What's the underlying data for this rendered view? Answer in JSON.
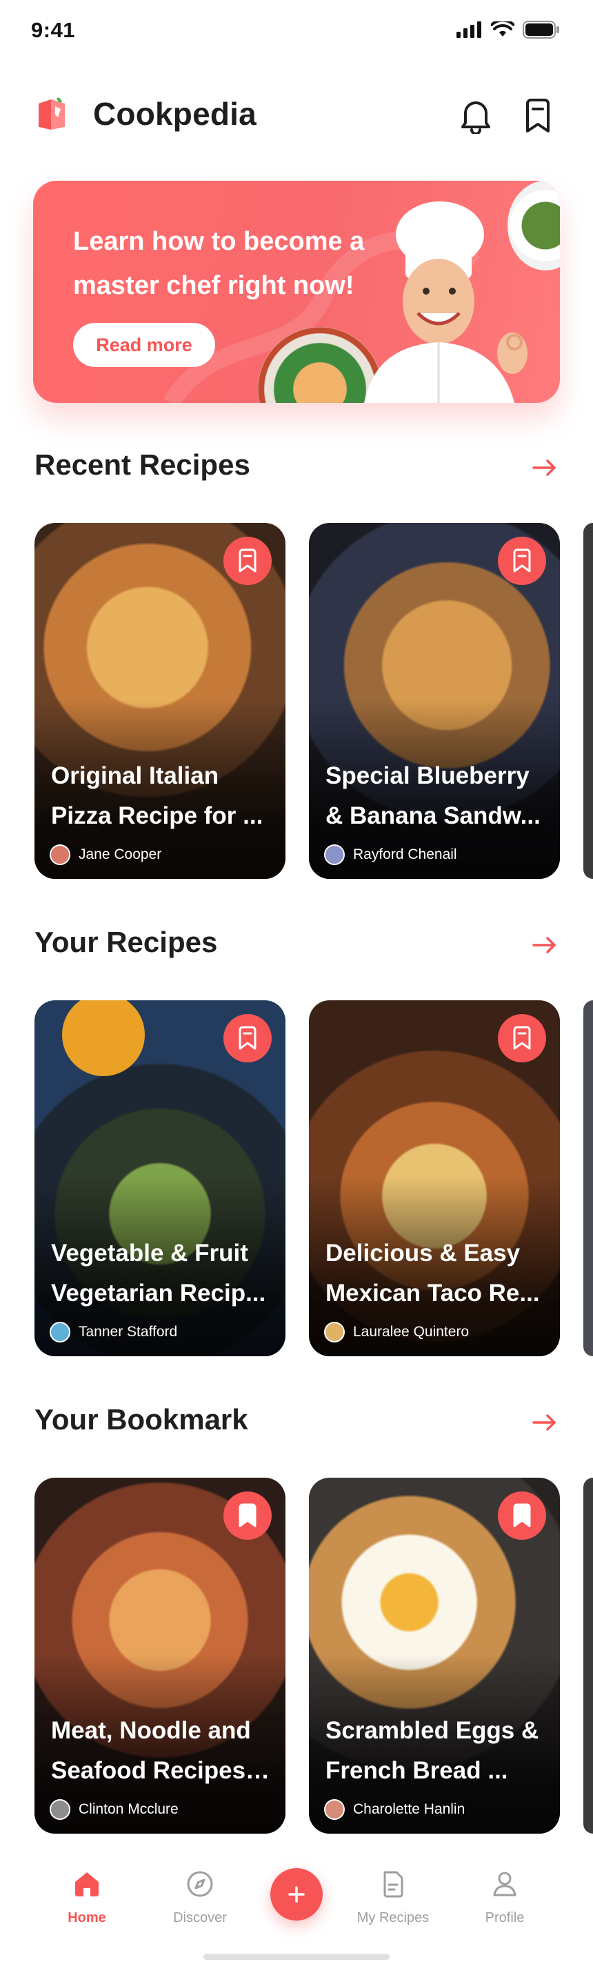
{
  "status_bar": {
    "time": "9:41"
  },
  "header": {
    "app_title": "Cookpedia"
  },
  "banner": {
    "text": "Learn how to become a master chef right now!",
    "button_label": "Read more"
  },
  "sections": [
    {
      "title": "Recent Recipes",
      "cards": [
        {
          "title": "Original Italian Pizza Recipe for ...",
          "author": "Jane Cooper",
          "bookmarked": false
        },
        {
          "title": "Special Blueberry & Banana Sandw...",
          "author": "Rayford Chenail",
          "bookmarked": false
        }
      ]
    },
    {
      "title": "Your Recipes",
      "cards": [
        {
          "title": "Vegetable & Fruit Vegetarian Recip...",
          "author": "Tanner Stafford",
          "bookmarked": false
        },
        {
          "title": "Delicious & Easy Mexican Taco Re...",
          "author": "Lauralee Quintero",
          "bookmarked": false
        }
      ]
    },
    {
      "title": "Your Bookmark",
      "cards": [
        {
          "title": "Meat, Noodle and Seafood Recipes ...",
          "author": "Clinton Mcclure",
          "bookmarked": true
        },
        {
          "title": "Scrambled Eggs & French Bread ...",
          "author": "Charolette Hanlin",
          "bookmarked": true
        }
      ]
    }
  ],
  "tabbar": {
    "home": "Home",
    "discover": "Discover",
    "my_recipes": "My Recipes",
    "profile": "Profile"
  },
  "colors": {
    "accent": "#F75555",
    "text": "#212121",
    "muted": "#9E9E9E"
  }
}
